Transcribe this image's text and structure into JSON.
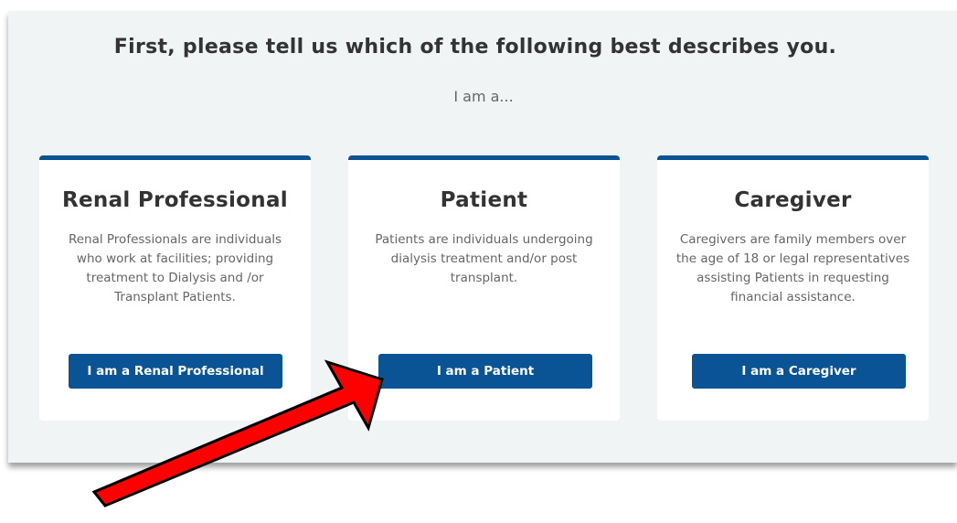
{
  "heading": "First, please tell us which of the following best describes you.",
  "subheading": "I am a...",
  "cards": [
    {
      "title": "Renal Professional",
      "description": "Renal Professionals are individuals who work at facilities; providing treatment to Dialysis and /or Transplant Patients.",
      "button_label": "I am a Renal Professional"
    },
    {
      "title": "Patient",
      "description": "Patients are individuals undergoing dialysis treatment and/or post transplant.",
      "button_label": "I am a Patient"
    },
    {
      "title": "Caregiver",
      "description": "Caregivers are family members over the age of 18 or legal representatives assisting Patients in requesting financial assistance.",
      "button_label": "I am a Caregiver"
    }
  ],
  "colors": {
    "accent": "#0a5394",
    "panel_background": "#f1f4f5",
    "annotation_arrow": "#ff0000"
  }
}
